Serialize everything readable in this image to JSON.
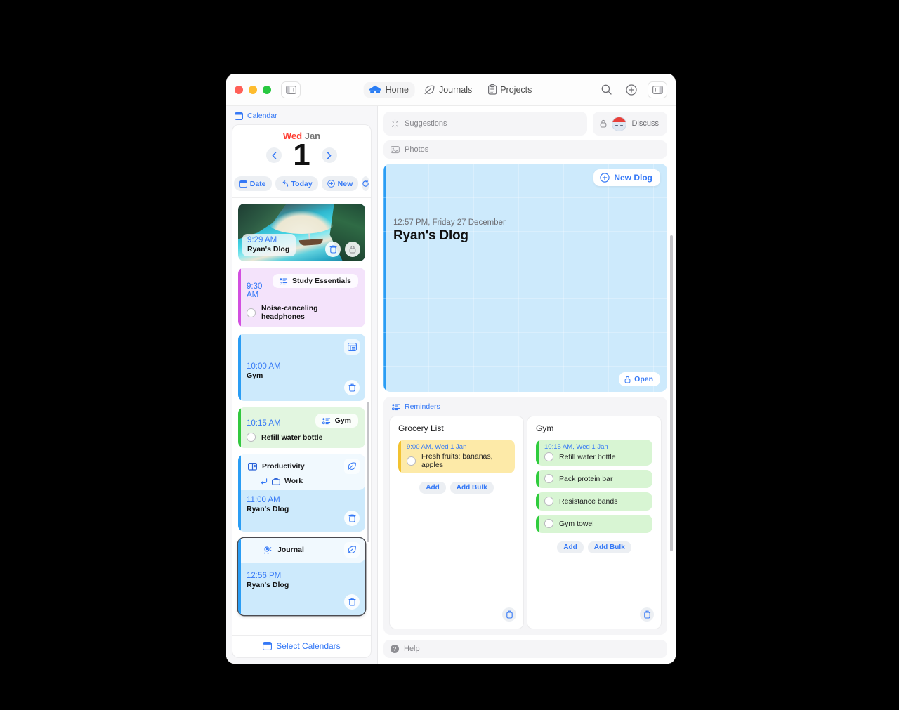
{
  "window": {
    "traffic_lights": [
      "close",
      "minimize",
      "maximize"
    ],
    "sidebar_toggle_icon": "sidebar-toggle-icon"
  },
  "nav": {
    "tabs": [
      {
        "label": "Home",
        "icon": "house-icon",
        "active": true
      },
      {
        "label": "Journals",
        "icon": "leaf-icon",
        "active": false
      },
      {
        "label": "Projects",
        "icon": "clipboard-icon",
        "active": false
      }
    ],
    "right_icons": [
      {
        "name": "search-icon"
      },
      {
        "name": "plus-circle-icon"
      },
      {
        "name": "inspector-toggle-icon"
      }
    ]
  },
  "sidebar": {
    "section_label": "Calendar",
    "section_icon": "calendar-icon",
    "date": {
      "weekday": "Wed",
      "month": "Jan",
      "day": "1",
      "prev_icon": "chevron-left-icon",
      "next_icon": "chevron-right-icon"
    },
    "buttons": [
      {
        "label": "Date",
        "icon": "calendar-icon"
      },
      {
        "label": "Today",
        "icon": "undo-arrow-icon"
      },
      {
        "label": "New",
        "icon": "plus-circle-icon"
      },
      {
        "label": "",
        "icon": "refresh-icon"
      }
    ],
    "footer": {
      "label": "Select Calendars",
      "icon": "calendar-icon"
    },
    "events": [
      {
        "kind": "photo",
        "time": "9:29 AM",
        "title": "Ryan's Dlog",
        "image_alt": "tropical lagoon with turquoise water, cliffs, boat and palm trees",
        "actions": [
          "trash-icon",
          "lock-icon"
        ]
      },
      {
        "kind": "task",
        "color": "purple",
        "time": "9:30 AM",
        "tag": "Study Essentials",
        "tag_icon": "list-bullet-icon",
        "checklist_label": "Noise-canceling headphones"
      },
      {
        "kind": "block",
        "color": "blue",
        "time": "10:00 AM",
        "title": "Gym",
        "corner_icon": "list-panel-icon",
        "actions": [
          "trash-icon"
        ]
      },
      {
        "kind": "task",
        "color": "green",
        "time": "10:15 AM",
        "tag": "Gym",
        "tag_icon": "list-bullet-icon",
        "checklist_label": "Refill water bottle"
      },
      {
        "kind": "block",
        "color": "blue",
        "time": "11:00 AM",
        "title": "Ryan's Dlog",
        "header_label": "Productivity",
        "header_icon": "book-icon",
        "header_action_icon": "leaf-icon",
        "sub_label": "Work",
        "sub_icon": "briefcase-icon",
        "sub_arrow_icon": "arrow-turn-icon",
        "actions": [
          "trash-icon"
        ]
      },
      {
        "kind": "block",
        "color": "blue",
        "selected": true,
        "time": "12:56 PM",
        "title": "Ryan's Dlog",
        "header_label": "Journal",
        "header_icon": "journal-dots-icon",
        "header_action_icon": "leaf-icon",
        "actions": [
          "trash-icon"
        ]
      }
    ]
  },
  "main": {
    "suggestions": {
      "label": "Suggestions",
      "icon": "sparkle-icon"
    },
    "discuss": {
      "label": "Discuss",
      "icon": "lock-icon",
      "avatar": "avatar-icon"
    },
    "photos": {
      "label": "Photos",
      "icon": "photo-icon"
    },
    "dlog": {
      "new_button": {
        "label": "New Dlog",
        "icon": "plus-circle-icon"
      },
      "timestamp": "12:57 PM, Friday 27 December",
      "title": "Ryan's Dlog",
      "open_button": {
        "label": "Open",
        "icon": "lock-icon"
      }
    },
    "reminders": {
      "section_label": "Reminders",
      "section_icon": "list-bullet-icon",
      "add_label": "Add",
      "add_bulk_label": "Add Bulk",
      "trash_icon": "trash-icon",
      "lists": [
        {
          "title": "Grocery List",
          "color": "yellow",
          "items": [
            {
              "time": "9:00 AM, Wed 1 Jan",
              "label": "Fresh fruits: bananas, apples"
            }
          ]
        },
        {
          "title": "Gym",
          "color": "green",
          "items": [
            {
              "time": "10:15 AM, Wed 1 Jan",
              "label": "Refill water bottle"
            },
            {
              "time": "",
              "label": "Pack protein bar"
            },
            {
              "time": "",
              "label": "Resistance bands"
            },
            {
              "time": "",
              "label": "Gym towel"
            }
          ]
        }
      ]
    },
    "help": {
      "label": "Help",
      "icon": "question-circle-icon"
    }
  },
  "colors": {
    "accent_blue": "#3478f6",
    "event_blue": "#cdeafc",
    "event_purple": "#f4e3fb",
    "event_green": "#e2f6e0",
    "reminder_yellow": "#fdeaa8",
    "reminder_green": "#d8f5d3",
    "weekday_red": "#ff3b30"
  }
}
